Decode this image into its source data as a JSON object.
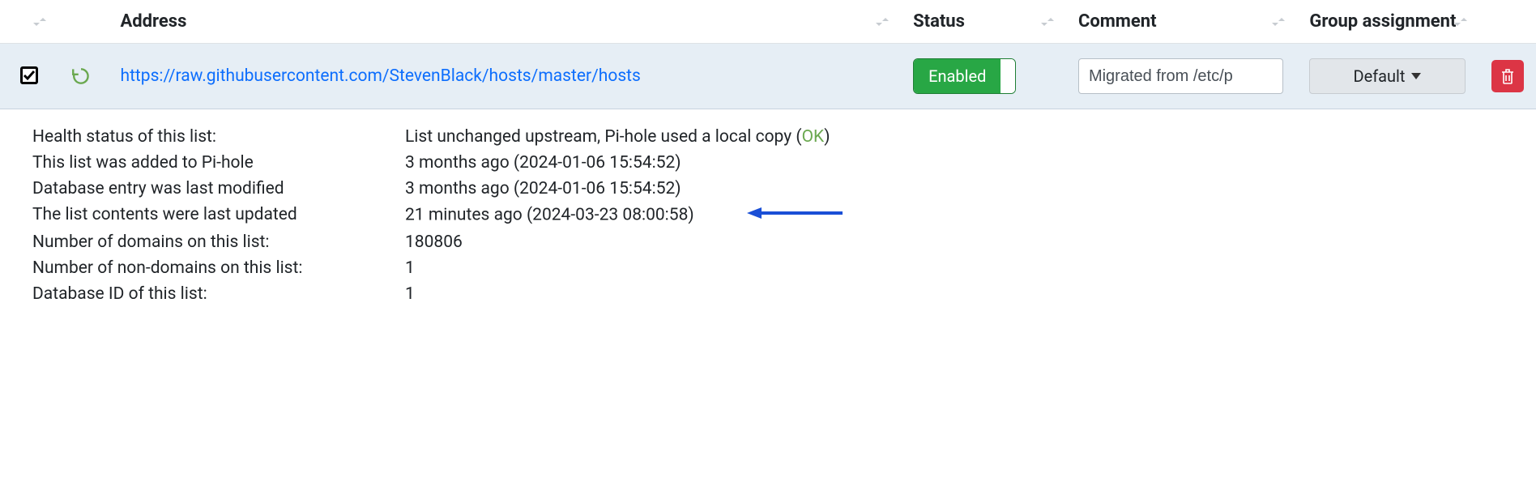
{
  "columns": {
    "address": "Address",
    "status": "Status",
    "comment": "Comment",
    "group": "Group assignment"
  },
  "row": {
    "address": "https://raw.githubusercontent.com/StevenBlack/hosts/master/hosts",
    "status_label": "Enabled",
    "comment_value": "Migrated from /etc/p",
    "group_label": "Default"
  },
  "details": {
    "health": {
      "label": "Health status of this list:",
      "value": "List unchanged upstream, Pi-hole used a local copy (",
      "ok": "OK",
      "suffix": ")"
    },
    "added": {
      "label": "This list was added to Pi-hole",
      "value": "3 months ago (2024-01-06 15:54:52)"
    },
    "modified": {
      "label": "Database entry was last modified",
      "value": "3 months ago (2024-01-06 15:54:52)"
    },
    "updated": {
      "label": "The list contents were last updated",
      "value": "21 minutes ago (2024-03-23 08:00:58)"
    },
    "domains": {
      "label": "Number of domains on this list:",
      "value": "180806"
    },
    "nondomains": {
      "label": "Number of non-domains on this list:",
      "value": "1"
    },
    "dbid": {
      "label": "Database ID of this list:",
      "value": "1"
    }
  }
}
